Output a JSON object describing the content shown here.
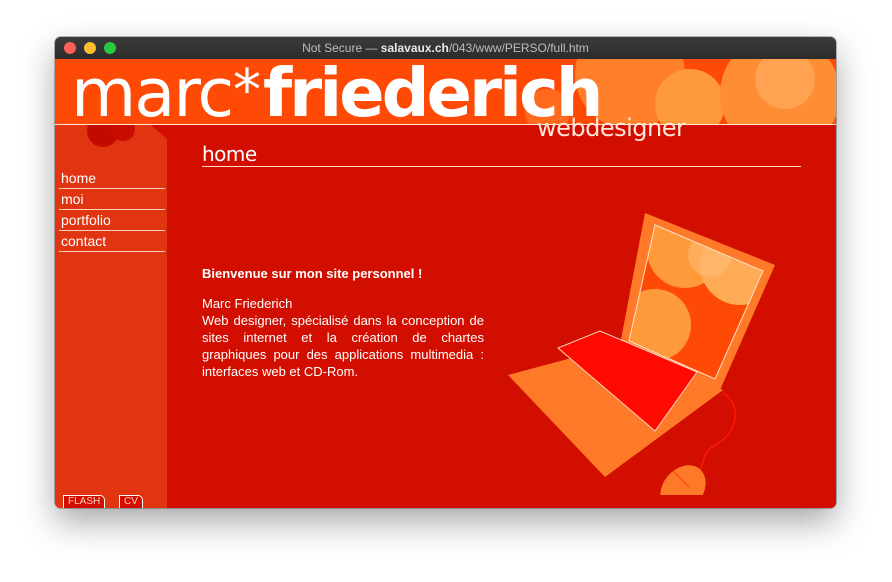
{
  "browser": {
    "title_prefix": "Not Secure — ",
    "domain": "salavaux.ch",
    "path": "/043/www/PERSO/full.htm"
  },
  "header": {
    "logo_first": "marc",
    "logo_star": "*",
    "logo_last": "friederich",
    "logo_sub": "webdesigner"
  },
  "nav": {
    "items": [
      "home",
      "moi",
      "portfolio",
      "contact"
    ]
  },
  "footer_tabs": {
    "flash": "FLASH",
    "cv": "CV"
  },
  "content": {
    "section_title": "home",
    "welcome": "Bienvenue sur mon site personnel !",
    "name": "Marc Friederich",
    "description": "Web designer, spécialisé dans la conception de sites internet et la création de chartes graphiques pour des applications multimedia : interfaces web et CD-Rom."
  },
  "colors": {
    "page_bg": "#d20e00",
    "header_bg": "#ff4a06",
    "sidebar_bg": "#e13410",
    "accent_orange": "#ff7a28"
  }
}
